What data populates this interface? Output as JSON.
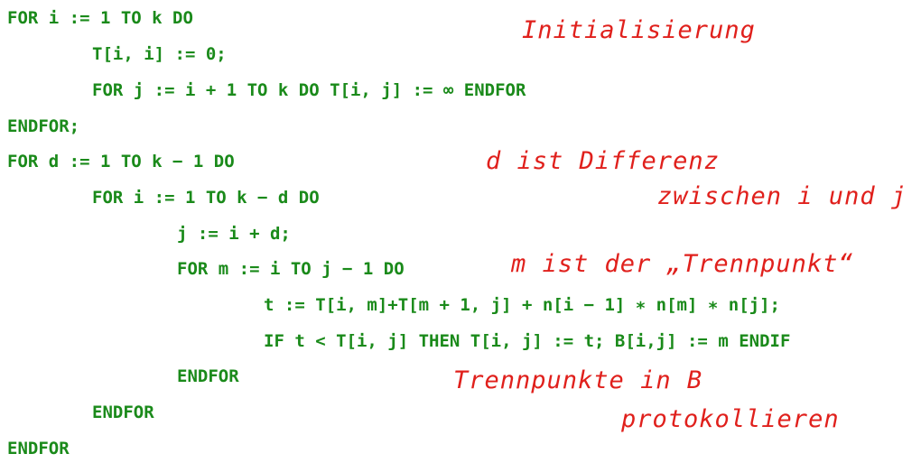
{
  "code": {
    "lines": [
      {
        "indent": 0,
        "text": "FOR i := 1 TO k DO"
      },
      {
        "indent": 1,
        "text": "T[i, i] := 0;"
      },
      {
        "indent": 1,
        "text": "FOR j := i + 1 TO k DO T[i, j] := ∞ ENDFOR"
      },
      {
        "indent": 0,
        "text": "ENDFOR;"
      },
      {
        "indent": 0,
        "text": "FOR d := 1 TO k − 1 DO"
      },
      {
        "indent": 1,
        "text": "FOR i := 1 TO k − d DO"
      },
      {
        "indent": 2,
        "text": "j := i + d;"
      },
      {
        "indent": 2,
        "text": "FOR m := i TO j − 1 DO"
      },
      {
        "indent": 3,
        "text": "t := T[i, m]+T[m + 1, j] + n[i − 1] ∗ n[m] ∗ n[j];"
      },
      {
        "indent": 3,
        "text": "IF t < T[i, j] THEN T[i, j] := t; B[i,j] := m ENDIF"
      },
      {
        "indent": 2,
        "text": "ENDFOR"
      },
      {
        "indent": 1,
        "text": "ENDFOR"
      },
      {
        "indent": 0,
        "text": "ENDFOR"
      }
    ]
  },
  "annotations": {
    "initialisierung": "Initialisierung",
    "d_differenz_1": "d ist Differenz",
    "d_differenz_2": "zwischen i und j",
    "trennpunkt": "m ist der „Trennpunkt“",
    "protokoll_1": "Trennpunkte in B",
    "protokoll_2": "protokollieren"
  },
  "colors": {
    "code": "#1a8a1a",
    "annotation": "#e0201c"
  }
}
